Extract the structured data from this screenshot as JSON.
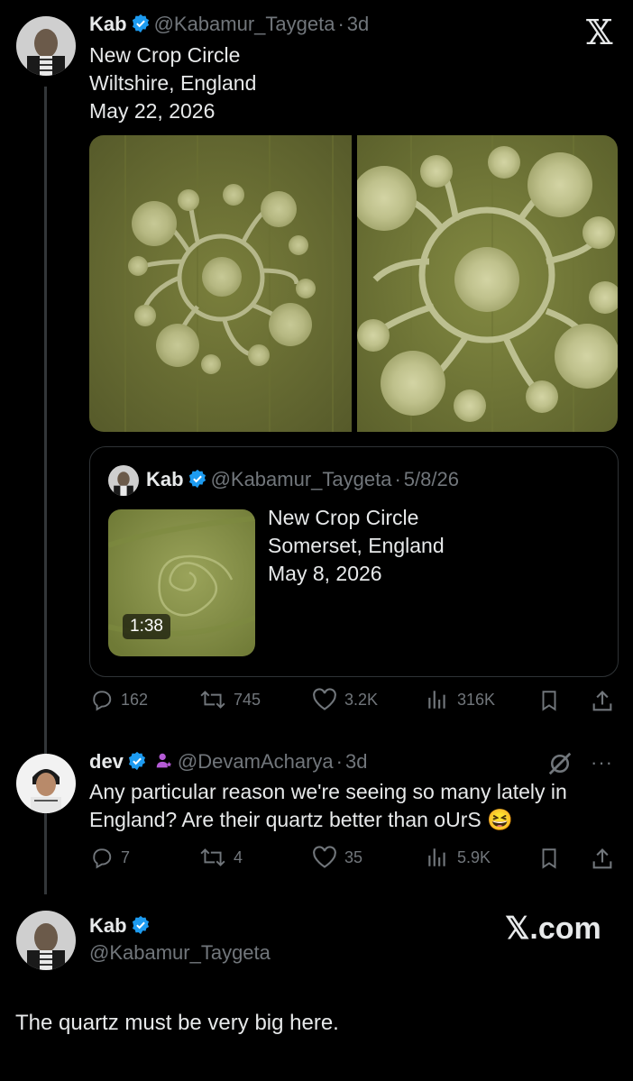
{
  "tweet1": {
    "name": "Kab",
    "handle": "@Kabamur_Taygeta",
    "sep": "·",
    "time": "3d",
    "lines": [
      "New Crop Circle",
      "Wiltshire, England",
      "May 22, 2026"
    ],
    "stats": {
      "replies": "162",
      "reposts": "745",
      "likes": "3.2K",
      "views": "316K"
    }
  },
  "quote": {
    "name": "Kab",
    "handle": "@Kabamur_Taygeta",
    "sep": "·",
    "time": "5/8/26",
    "lines": [
      "New Crop Circle",
      "Somerset, England",
      "May 8, 2026"
    ],
    "video_duration": "1:38"
  },
  "tweet2": {
    "name": "dev",
    "handle": "@DevamAcharya",
    "sep": "·",
    "time": "3d",
    "text_line1": "Any particular reason we're seeing so many lately in",
    "text_line2": "England? Are their quartz better than oUrS",
    "emoji": "😆",
    "stats": {
      "replies": "7",
      "reposts": "4",
      "likes": "35",
      "views": "5.9K"
    }
  },
  "tweet3": {
    "name": "Kab",
    "handle": "@Kabamur_Taygeta",
    "text": "The quartz must be very big here.",
    "watermark": "𝕏.com"
  },
  "icons": {
    "x_logo": "𝕏",
    "more": "···"
  },
  "colors": {
    "background": "#000000",
    "verified": "#1d9bf0",
    "muted": "#71767b",
    "affiliate": "#b55bd6"
  }
}
